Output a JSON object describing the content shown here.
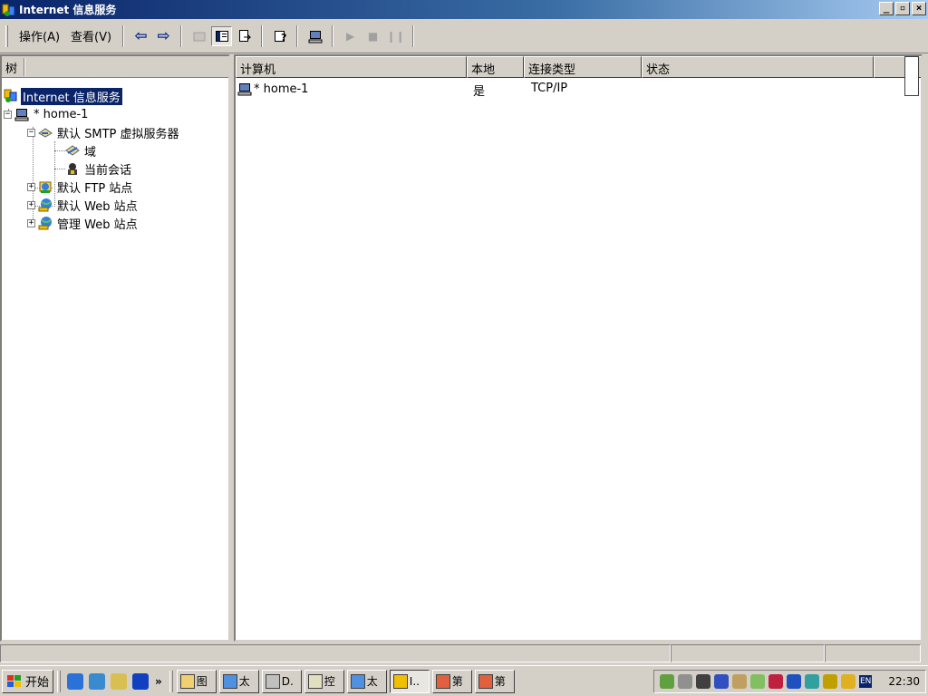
{
  "window": {
    "title": "Internet 信息服务",
    "controls": [
      "_",
      "▫",
      "×"
    ]
  },
  "toolbar": {
    "menus": [
      "操作(A)",
      "查看(V)"
    ],
    "buttons": [
      "back",
      "forward",
      "up",
      "show-hide-tree",
      "export-list",
      "help",
      "computer",
      "start",
      "stop",
      "pause"
    ]
  },
  "tree": {
    "header": "树",
    "items": [
      {
        "label": "Internet 信息服务",
        "icon": "iis-icon",
        "selected": true
      },
      {
        "label": "* home-1",
        "icon": "computer-icon",
        "expander": "−"
      },
      {
        "label": "默认 SMTP 虚拟服务器",
        "icon": "smtp-server-icon",
        "expander": "−"
      },
      {
        "label": "域",
        "icon": "domain-icon"
      },
      {
        "label": "当前会话",
        "icon": "session-icon"
      },
      {
        "label": "默认 FTP 站点",
        "icon": "ftp-site-icon",
        "expander": "+"
      },
      {
        "label": "默认 Web 站点",
        "icon": "web-site-icon",
        "expander": "+"
      },
      {
        "label": "管理 Web 站点",
        "icon": "web-site-icon",
        "expander": "+"
      }
    ]
  },
  "list": {
    "columns": [
      "计算机",
      "本地",
      "连接类型",
      "状态"
    ],
    "rows": [
      {
        "computer": "* home-1",
        "local": "是",
        "conn_type": "TCP/IP",
        "status": ""
      }
    ]
  },
  "taskbar": {
    "start_label": "开始",
    "chevron": "»",
    "tasks": [
      {
        "label": "图",
        "icon": "folder-icon"
      },
      {
        "label": "太",
        "icon": "ie-icon"
      },
      {
        "label": "D.",
        "icon": "drive-icon"
      },
      {
        "label": "控",
        "icon": "control-panel-icon"
      },
      {
        "label": "太",
        "icon": "ie-icon"
      },
      {
        "label": "I..",
        "icon": "iis-icon",
        "active": true
      },
      {
        "label": "第",
        "icon": "ppt-icon"
      },
      {
        "label": "第",
        "icon": "ppt-icon"
      }
    ],
    "lang": "EN",
    "clock": "22:30"
  }
}
